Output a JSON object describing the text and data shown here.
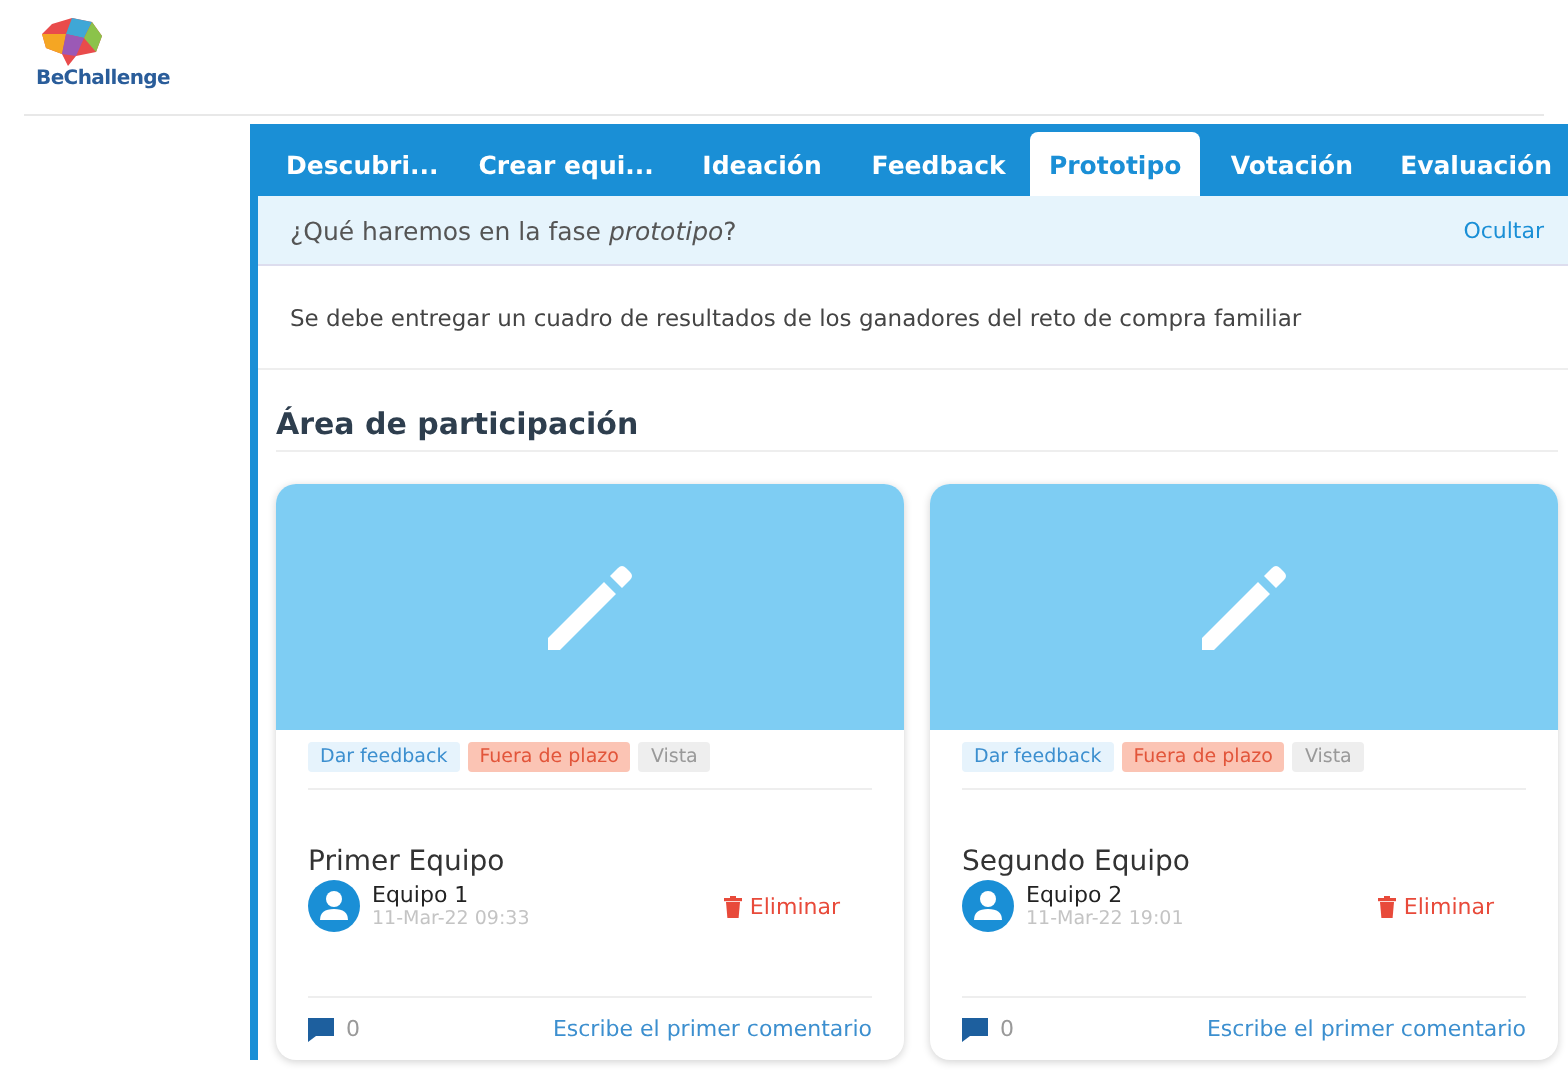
{
  "logo": {
    "text": "BeChallenge"
  },
  "tabs": [
    {
      "label": "Descubri...",
      "selected": false
    },
    {
      "label": "Crear equi...",
      "selected": false
    },
    {
      "label": "Ideación",
      "selected": false
    },
    {
      "label": "Feedback",
      "selected": false
    },
    {
      "label": "Prototipo",
      "selected": true
    },
    {
      "label": "Votación",
      "selected": false
    },
    {
      "label": "Evaluación",
      "selected": false
    }
  ],
  "info_bar": {
    "question": "¿Qué haremos en la fase *prototipo*?",
    "toggle": "Ocultar"
  },
  "description": "Se debe entregar un cuadro de resultados de los ganadores del reto de compra familiar",
  "section_title": "Área de participación",
  "cards": [
    {
      "tags": [
        {
          "label": "Dar feedback",
          "kind": "action"
        },
        {
          "label": "Fuera de plazo",
          "kind": "warning"
        },
        {
          "label": "Vista",
          "kind": "neutral"
        }
      ],
      "title": "Primer Equipo",
      "team": "Equipo 1",
      "date": "11-Mar-22 09:33",
      "delete": "Eliminar",
      "comment_count": "0",
      "comment_link": "Escribe el primer comentario"
    },
    {
      "tags": [
        {
          "label": "Dar feedback",
          "kind": "action"
        },
        {
          "label": "Fuera de plazo",
          "kind": "warning"
        },
        {
          "label": "Vista",
          "kind": "neutral"
        }
      ],
      "title": "Segundo Equipo",
      "team": "Equipo 2",
      "date": "11-Mar-22 19:01",
      "delete": "Eliminar",
      "comment_count": "0",
      "comment_link": "Escribe el primer comentario"
    }
  ]
}
